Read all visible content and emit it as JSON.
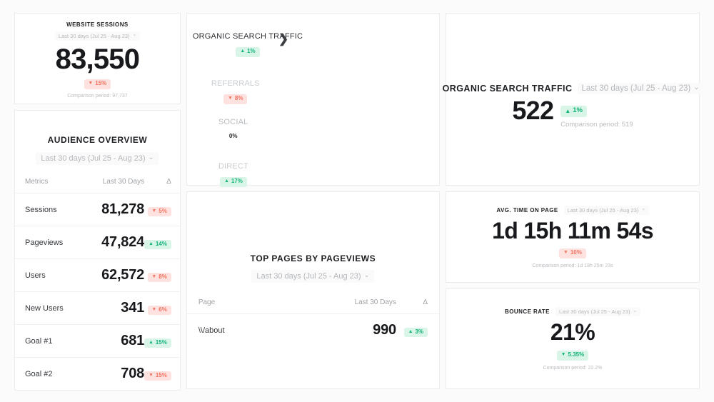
{
  "website_sessions": {
    "title": "WEBSITE SESSIONS",
    "date_range": "Last 30 days (Jul 25 - Aug 23)",
    "value": "83,550",
    "delta": "15%",
    "delta_direction": "down",
    "delta_arrow": "▼",
    "comparison": "Comparison period: 97,737"
  },
  "audience_overview": {
    "title": "AUDIENCE OVERVIEW",
    "date_range": "Last 30 days (Jul 25 - Aug 23)",
    "columns": [
      "Metrics",
      "Last 30 Days",
      "Δ"
    ],
    "rows": [
      {
        "metric": "Sessions",
        "value": "81,278",
        "delta": "5%",
        "direction": "down",
        "arrow": "▼"
      },
      {
        "metric": "Pageviews",
        "value": "47,824",
        "delta": "14%",
        "direction": "up",
        "arrow": "▲"
      },
      {
        "metric": "Users",
        "value": "62,572",
        "delta": "8%",
        "direction": "down",
        "arrow": "▼"
      },
      {
        "metric": "New Users",
        "value": "341",
        "delta": "6%",
        "direction": "down",
        "arrow": "▼"
      },
      {
        "metric": "Goal #1",
        "value": "681",
        "delta": "15%",
        "direction": "up",
        "arrow": "▲"
      },
      {
        "metric": "Goal #2",
        "value": "708",
        "delta": "15%",
        "direction": "down",
        "arrow": "▼"
      }
    ]
  },
  "traffic_sources": {
    "expand_icon": "❯",
    "items": [
      {
        "label": "ORGANIC SEARCH TRAFFIC",
        "delta": "1%",
        "direction": "up",
        "arrow": "▲",
        "selected": true
      },
      {
        "label": "REFERRALS",
        "delta": "8%",
        "direction": "down",
        "arrow": "▼",
        "selected": false
      },
      {
        "label": "SOCIAL",
        "delta": "0%",
        "direction": "flat",
        "arrow": "",
        "selected": false
      },
      {
        "label": "DIRECT",
        "delta": "17%",
        "direction": "up",
        "arrow": "▲",
        "selected": false
      }
    ]
  },
  "organic_detail": {
    "title": "ORGANIC SEARCH TRAFFIC",
    "date_range": "Last 30 days (Jul 25 - Aug 23)",
    "value": "522",
    "delta": "1%",
    "delta_direction": "up",
    "delta_arrow": "▲",
    "comparison": "Comparison period: 519"
  },
  "top_pages": {
    "title": "TOP PAGES BY PAGEVIEWS",
    "date_range": "Last 30 days (Jul 25 - Aug 23)",
    "columns": [
      "Page",
      "Last 30 Days",
      "Δ"
    ],
    "rows": [
      {
        "page": "\\\\/about",
        "value": "990",
        "delta": "3%",
        "direction": "up",
        "arrow": "▲"
      }
    ]
  },
  "avg_time_on_page": {
    "title": "AVG. TIME ON PAGE",
    "date_range": "Last 30 days (Jul 25 - Aug 23)",
    "value": "1d 15h 11m 54s",
    "delta": "10%",
    "delta_direction": "down",
    "delta_arrow": "▼",
    "comparison": "Comparison period: 1d 19h 25m 23s"
  },
  "bounce_rate": {
    "title": "BOUNCE RATE",
    "date_range": "Last 30 days (Jul 25 - Aug 23)",
    "value": "21%",
    "delta": "5.35%",
    "delta_direction": "up",
    "delta_arrow": "▼",
    "comparison": "Comparison period: 22.2%"
  },
  "icons": {
    "caret_down": "⌄"
  },
  "colors": {
    "page_bg": "#fbfbfb",
    "card_bg": "#ffffff",
    "card_border": "#ececed",
    "positive": "#12b37a",
    "positive_bg": "#d8f5e8",
    "negative": "#f4715f",
    "negative_bg": "#fde2e0",
    "text": "#18191c",
    "muted": "#b4b7bb"
  }
}
